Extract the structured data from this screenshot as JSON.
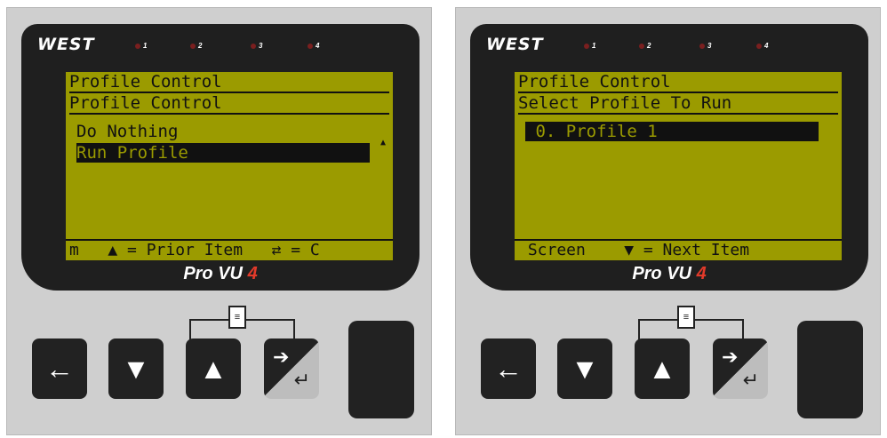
{
  "panels": [
    {
      "brand": "WEST",
      "leds": [
        "1",
        "2",
        "3",
        "4"
      ],
      "lcd": {
        "title": "Profile Control",
        "subtitle": "Profile Control",
        "items": [
          {
            "label": "Do Nothing",
            "selected": false
          },
          {
            "label": "Run Profile",
            "selected": true
          }
        ],
        "scroll_indicator": "▲",
        "footer": "m   ▲ = Prior Item   ⇄ = C"
      },
      "logo": {
        "text": "Pro VU ",
        "number": "4"
      },
      "keys": {
        "left": "←",
        "down": "▼",
        "up": "▲",
        "enter_top": "➔",
        "enter_bottom": "↵"
      },
      "doc_icon": "≡"
    },
    {
      "brand": "WEST",
      "leds": [
        "1",
        "2",
        "3",
        "4"
      ],
      "lcd": {
        "title": "Profile Control",
        "subtitle": "Select Profile To Run",
        "items": [
          {
            "label": " 0. Profile 1",
            "selected": true
          }
        ],
        "footer": " Screen    ▼ = Next Item"
      },
      "logo": {
        "text": "Pro VU ",
        "number": "4"
      },
      "keys": {
        "left": "←",
        "down": "▼",
        "up": "▲",
        "enter_top": "➔",
        "enter_bottom": "↵"
      },
      "doc_icon": "≡"
    }
  ]
}
